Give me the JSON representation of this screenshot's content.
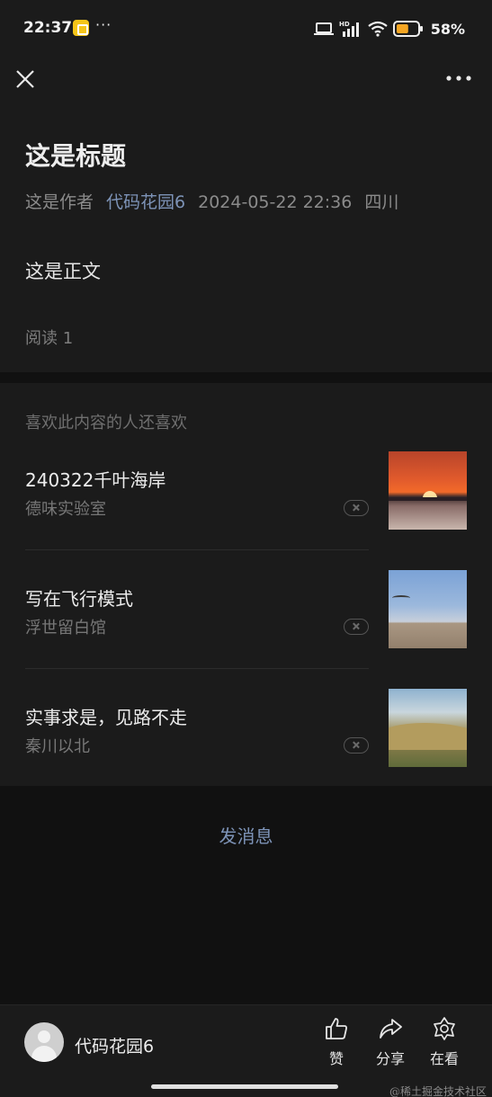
{
  "status_bar": {
    "time": "22:37",
    "more": "···",
    "battery_percent": "58%",
    "battery_level": 0.58,
    "icons": [
      "notification-app-icon",
      "laptop-icon",
      "hd-signal-icon",
      "wifi-icon",
      "battery-icon"
    ]
  },
  "article": {
    "title": "这是标题",
    "author": "这是作者",
    "author_link": "代码花园6",
    "date": "2024-05-22 22:36",
    "region": "四川",
    "body": "这是正文",
    "read_count": "阅读 1"
  },
  "recommendations": {
    "heading": "喜欢此内容的人还喜欢",
    "items": [
      {
        "title": "240322千叶海岸",
        "source": "德味实验室",
        "thumb": "sunset-sea"
      },
      {
        "title": "写在飞行模式",
        "source": "浮世留白馆",
        "thumb": "sky-bird"
      },
      {
        "title": "实事求是，见路不走",
        "source": "秦川以北",
        "thumb": "hills"
      }
    ]
  },
  "send_message": "发消息",
  "bottom_bar": {
    "author": "代码花园6",
    "actions": [
      {
        "label": "赞",
        "icon": "thumbs-up-icon"
      },
      {
        "label": "分享",
        "icon": "share-icon"
      },
      {
        "label": "在看",
        "icon": "wow-icon"
      }
    ]
  },
  "watermark": "@稀土掘金技术社区",
  "colors": {
    "background": "#111111",
    "panel": "#1b1b1b",
    "link": "#7d93b7",
    "battery": "#f5a623"
  }
}
